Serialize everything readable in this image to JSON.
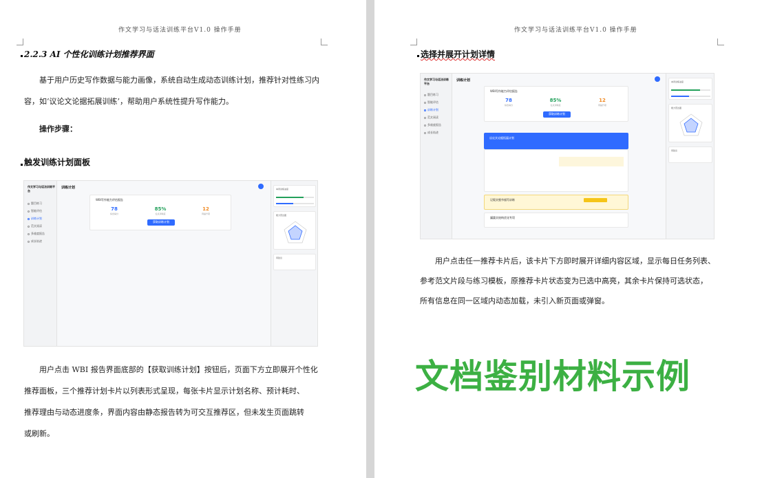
{
  "header_text": "作文学习与话法训练平台V1.0 操作手册",
  "left": {
    "heading": "2.2.3 AI 个性化训练计划推荐界面",
    "intro": "基于用户历史写作数据与能力画像，系统自动生成动态训练计划，推荐针对性练习内容，如‘议论文论据拓展训练’，帮助用户系统性提升写作能力。",
    "steps_label": "操作步骤：",
    "subheading": "触发训练计划面板",
    "body_lines": [
      "用户点击 WBI 报告界面底部的【获取训练计划】按钮后，页面下方立即展开个性化",
      "推荐面板，三个推荐计划卡片以列表形式呈现，每张卡片显示计划名称、预计耗时、",
      "推荐理由与动态进度条，界面内容由静态报告转为可交互推荐区，但未发生页面跳转",
      "或刷新。"
    ]
  },
  "right": {
    "subheading": "选择并展开计划详情",
    "body_lines": [
      "用户点击任一推荐卡片后，该卡片下方即时展开详细内容区域，显示每日任务列表、",
      "参考范文片段与练习模板，原推荐卡片状态变为已选中高亮，其余卡片保持可选状态，",
      "所有信息在同一区域内动态加载，未引入新页面或弹窗。"
    ]
  },
  "screenshot": {
    "brand": "作文学习与话法训练平台",
    "title": "训练计划",
    "nav": [
      "题目练习",
      "智能评估",
      "训练计划",
      "范文阅读",
      "多维度报告",
      "成长轨迹"
    ],
    "active_nav_index": 2,
    "report_title": "WBI写作能力评估报告",
    "stats": [
      {
        "value": "78",
        "label": "综合得分",
        "color": "#2f6bff"
      },
      {
        "value": "85%",
        "label": "论点清晰度",
        "color": "#22a05a"
      },
      {
        "value": "12",
        "label": "待提升项",
        "color": "#f08a24"
      }
    ],
    "button": "获取训练计划",
    "right_panel_title": "本周训练进度",
    "radar_title": "能力雷达图",
    "tips_title": "待建议",
    "plans": [
      "议论文论据拓展计划",
      "记叙文细节描写训练",
      "議論文结构优化专项"
    ]
  },
  "watermark": "文档鉴别材料示例"
}
